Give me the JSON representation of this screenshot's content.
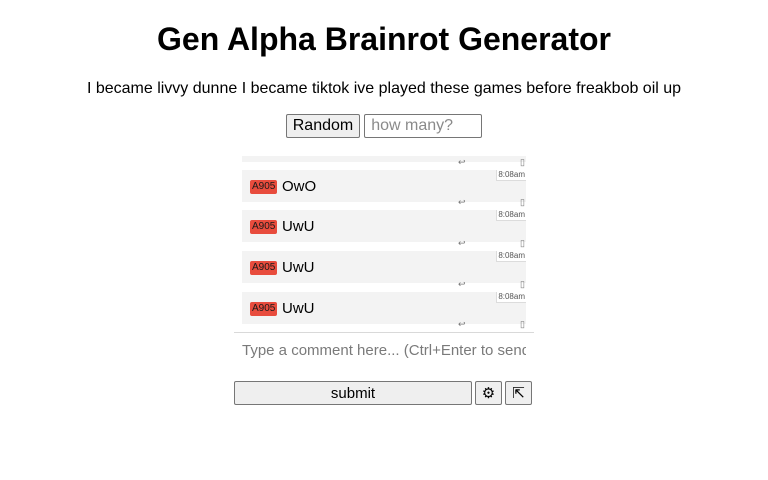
{
  "title": "Gen Alpha Brainrot Generator",
  "sentence": "I became livvy dunne I became tiktok ive played these games before freakbob oil up",
  "controls": {
    "random_label": "Random",
    "count_placeholder": "how many?"
  },
  "comments": [
    {
      "badge": "A905",
      "text": "OwO",
      "time": "8:08am"
    },
    {
      "badge": "A905",
      "text": "UwU",
      "time": "8:08am"
    },
    {
      "badge": "A905",
      "text": "UwU",
      "time": "8:08am"
    },
    {
      "badge": "A905",
      "text": "UwU",
      "time": "8:08am"
    }
  ],
  "icons": {
    "reply": "reply-icon",
    "flag": "flag-icon",
    "settings": "gear-icon",
    "popout": "popout-icon"
  },
  "comment_input": {
    "placeholder": "Type a comment here... (Ctrl+Enter to send)"
  },
  "actions": {
    "submit_label": "submit",
    "settings_glyph": "⚙",
    "popout_glyph": "⇱"
  },
  "glyphs": {
    "reply": "↩",
    "flag": "▯"
  }
}
